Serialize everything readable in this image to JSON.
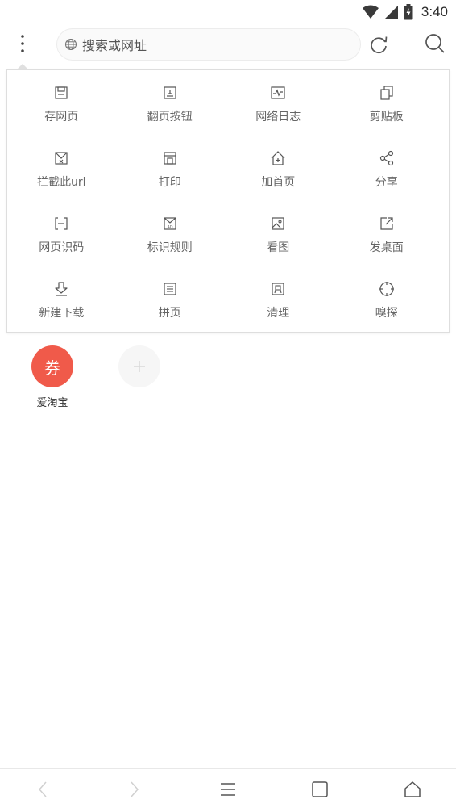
{
  "status_bar": {
    "time": "3:40",
    "icons": [
      "wifi-icon",
      "signal-icon",
      "battery-charging-icon"
    ]
  },
  "top_bar": {
    "menu_icon": "more-vertical-icon",
    "search": {
      "icon": "globe-icon",
      "placeholder": "搜索或网址"
    },
    "refresh_icon": "refresh-icon",
    "search_icon": "search-icon"
  },
  "menu": {
    "items": [
      {
        "label": "存网页",
        "icon": "save-page-icon"
      },
      {
        "label": "翻页按钮",
        "icon": "page-button-icon"
      },
      {
        "label": "网络日志",
        "icon": "network-log-icon"
      },
      {
        "label": "剪贴板",
        "icon": "clipboard-icon"
      },
      {
        "label": "拦截此url",
        "icon": "block-url-icon"
      },
      {
        "label": "打印",
        "icon": "print-icon"
      },
      {
        "label": "加首页",
        "icon": "add-home-icon"
      },
      {
        "label": "分享",
        "icon": "share-icon"
      },
      {
        "label": "网页识码",
        "icon": "scan-code-icon"
      },
      {
        "label": "标识规则",
        "icon": "ad-rule-icon"
      },
      {
        "label": "看图",
        "icon": "image-view-icon"
      },
      {
        "label": "发桌面",
        "icon": "send-desktop-icon"
      },
      {
        "label": "新建下载",
        "icon": "new-download-icon"
      },
      {
        "label": "拼页",
        "icon": "merge-page-icon"
      },
      {
        "label": "清理",
        "icon": "clean-icon"
      },
      {
        "label": "嗅探",
        "icon": "sniff-icon"
      }
    ]
  },
  "shortcuts": [
    {
      "label": "爱淘宝",
      "glyph": "券",
      "color": "#f05a4a"
    },
    {
      "label": "",
      "glyph": "+",
      "icon": "add-icon"
    }
  ],
  "bottom_nav": {
    "items": [
      "back-icon",
      "forward-icon",
      "menu-lines-icon",
      "tabs-icon",
      "home-icon"
    ]
  }
}
